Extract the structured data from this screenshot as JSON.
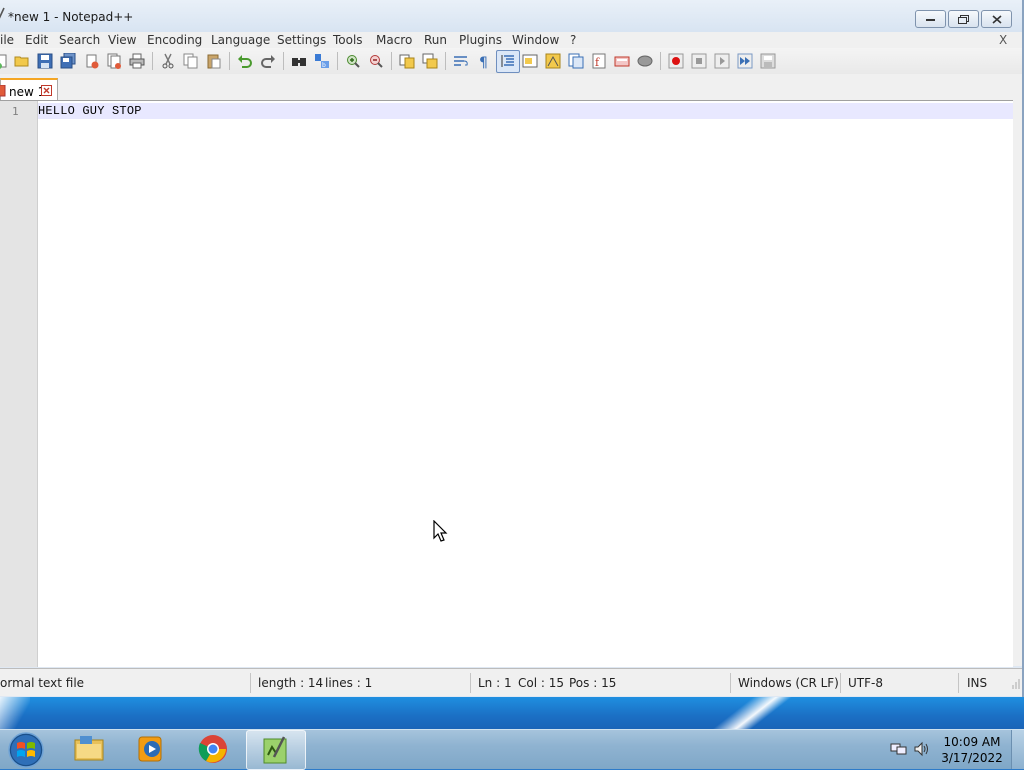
{
  "window": {
    "title": "*new 1 - Notepad++",
    "controls": {
      "minimize": "minimize-icon",
      "maximize": "maximize-icon",
      "close": "close-icon"
    }
  },
  "menu": {
    "items": [
      "ile",
      "Edit",
      "Search",
      "View",
      "Encoding",
      "Language",
      "Settings",
      "Tools",
      "Macro",
      "Run",
      "Plugins",
      "Window",
      "?"
    ],
    "close_doc": "X"
  },
  "toolbar": {
    "icons": [
      "new-icon",
      "open-icon",
      "save-icon",
      "save-all-icon",
      "close-icon",
      "close-all-icon",
      "print-icon",
      "cut-icon",
      "copy-icon",
      "paste-icon",
      "undo-icon",
      "redo-icon",
      "find-icon",
      "replace-icon",
      "zoom-in-icon",
      "zoom-out-icon",
      "sync-vertical-icon",
      "sync-horizontal-icon",
      "word-wrap-icon",
      "show-all-chars-icon",
      "indent-guide-icon",
      "folder-as-workspace-icon",
      "document-map-icon",
      "function-list-icon",
      "document-list-icon",
      "monitoring-icon",
      "open-folder-icon",
      "bubble-icon",
      "record-macro-icon",
      "stop-recording-icon",
      "play-macro-icon",
      "run-macro-multiple-icon",
      "save-macro-icon"
    ],
    "selected": "indent-guide-icon"
  },
  "tabs": [
    {
      "label": "new 1",
      "modified": true,
      "active": true
    }
  ],
  "editor": {
    "lines": [
      {
        "number": "1",
        "text": "HELLO GUY STOP"
      }
    ]
  },
  "status": {
    "file_type": "ormal text file",
    "length": "length : 14",
    "lines": "lines : 1",
    "ln": "Ln : 1",
    "col": "Col : 15",
    "pos": "Pos : 15",
    "eol": "Windows (CR LF)",
    "encoding": "UTF-8",
    "mode": "INS"
  },
  "taskbar": {
    "pinned": [
      "start-orb-icon",
      "file-explorer-icon",
      "media-player-icon",
      "chrome-icon",
      "notepad-plus-plus-icon"
    ],
    "active": "notepad-plus-plus-icon",
    "tray": [
      "network-icon",
      "volume-icon"
    ],
    "time": "10:09 AM",
    "date": "3/17/2022"
  },
  "colors": {
    "current_line": "#e8e8ff",
    "tab_accent": "#f5a623",
    "desktop": "#1b6fc4"
  }
}
